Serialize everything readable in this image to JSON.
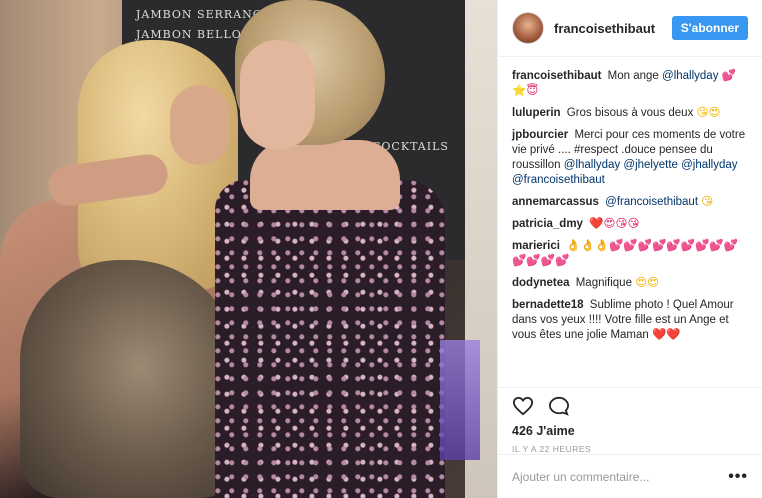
{
  "post": {
    "username": "francoisethibaut",
    "follow_label": "S'abonner"
  },
  "comments": [
    {
      "user": "francoisethibaut",
      "text": "Mon ange",
      "mention": "@lhallyday",
      "emoji": "💕⭐😇"
    },
    {
      "user": "luluperin",
      "text": "Gros bisous à vous deux",
      "emoji": "😘😍"
    },
    {
      "user": "jpbourcier",
      "text": "Merci pour ces moments de votre vie privé .... #respect .douce pensee du roussillon",
      "mention": "@lhallyday @jhelyette @jhallyday @francoisethibaut"
    },
    {
      "user": "annemarcassus",
      "mention": "@francoisethibaut",
      "emoji": "😘"
    },
    {
      "user": "patricia_dmy",
      "emoji": "❤️😍😘😘"
    },
    {
      "user": "marierici",
      "emoji": "👌👌👌💕💕💕💕💕💕💕💕💕💕💕💕💕"
    },
    {
      "user": "dodynetea",
      "text": "Magnifique",
      "emoji": "😍😍"
    },
    {
      "user": "bernadette18",
      "text": "Sublime photo ! Quel Amour dans vos yeux !!!! Votre fille est un Ange et vous êtes une jolie Maman",
      "emoji": "❤️❤️"
    }
  ],
  "actions": {
    "heart_icon": "heart-icon",
    "comment_icon": "comment-icon",
    "likes": "426 J'aime",
    "time": "Il y a 22 heures"
  },
  "add_comment": {
    "placeholder": "Ajouter un commentaire...",
    "more_label": "•••"
  },
  "photo_chalkboard": [
    "JAMBON SERRANO",
    "JAMBON BELLOTA",
    "COCKTAILS"
  ]
}
